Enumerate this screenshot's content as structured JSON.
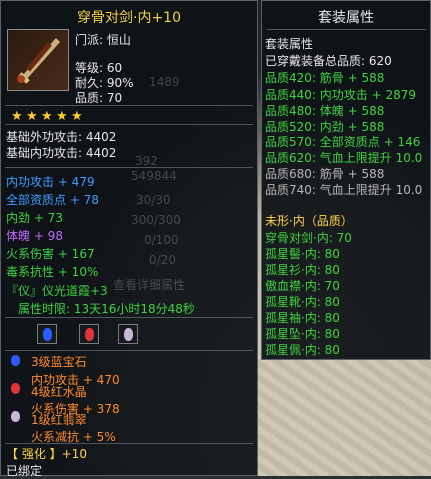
{
  "left": {
    "title": "穿骨对剑·内+10",
    "info": [
      "门派: 恒山",
      "等级: 60",
      "耐久: 90%",
      "品质: 70"
    ],
    "stars": 5,
    "base": [
      "基础外功攻击: 4402",
      "基础内功攻击: 4402"
    ],
    "attrs": [
      {
        "text": "内功攻击 + 479",
        "color": "blue"
      },
      {
        "text": "全部资质点 + 78",
        "color": "blue"
      },
      {
        "text": "内劲 + 73",
        "color": "green"
      },
      {
        "text": "体魄 + 98",
        "color": "purple"
      },
      {
        "text": "火系伤害 + 167",
        "color": "green"
      },
      {
        "text": "毒系抗性 + 10%",
        "color": "green"
      }
    ],
    "bond": "『仪』仪光道霞+3",
    "bond_time": "属性时限: 13天16小时18分48秒",
    "gems": [
      {
        "name": "3级蓝宝石",
        "effect": "内功攻击 + 470"
      },
      {
        "name": "4级红水晶",
        "effect": "火系伤害 + 378"
      },
      {
        "name": "1级红翡翠",
        "effect": "火系减抗 + 5%"
      }
    ],
    "enhance": "【 强化 】+10",
    "bound": "已绑定",
    "faint_numbers": [
      "1489",
      "392",
      "549844",
      "30/30",
      "300/300",
      "0/100",
      "0/20",
      "查看详细属性"
    ]
  },
  "right": {
    "title": "套装属性",
    "header": "套装属性",
    "total": "已穿戴装备总品质: 620",
    "tiers": [
      {
        "text": "品质420: 筋骨 + 588",
        "color": "green"
      },
      {
        "text": "品质440: 内功攻击 + 2879",
        "color": "green"
      },
      {
        "text": "品质480: 体魄 + 588",
        "color": "green"
      },
      {
        "text": "品质520: 内劲 + 588",
        "color": "green"
      },
      {
        "text": "品质570: 全部资质点 + 146",
        "color": "green"
      },
      {
        "text": "品质620: 气血上限提升 10.0",
        "color": "green"
      },
      {
        "text": "品质680: 筋骨 + 588",
        "color": "grey"
      },
      {
        "text": "品质740: 气血上限提升 10.0",
        "color": "grey"
      }
    ],
    "set_name": "未形·内（品质）",
    "pieces": [
      "穿骨对剑·内: 70",
      "孤星髻·内: 80",
      "孤星衫·内: 80",
      "傲血襟·内: 70",
      "孤星靴·内: 80",
      "孤星袖·内: 80",
      "孤星坠·内: 80",
      "孤星佩·内: 80"
    ]
  }
}
